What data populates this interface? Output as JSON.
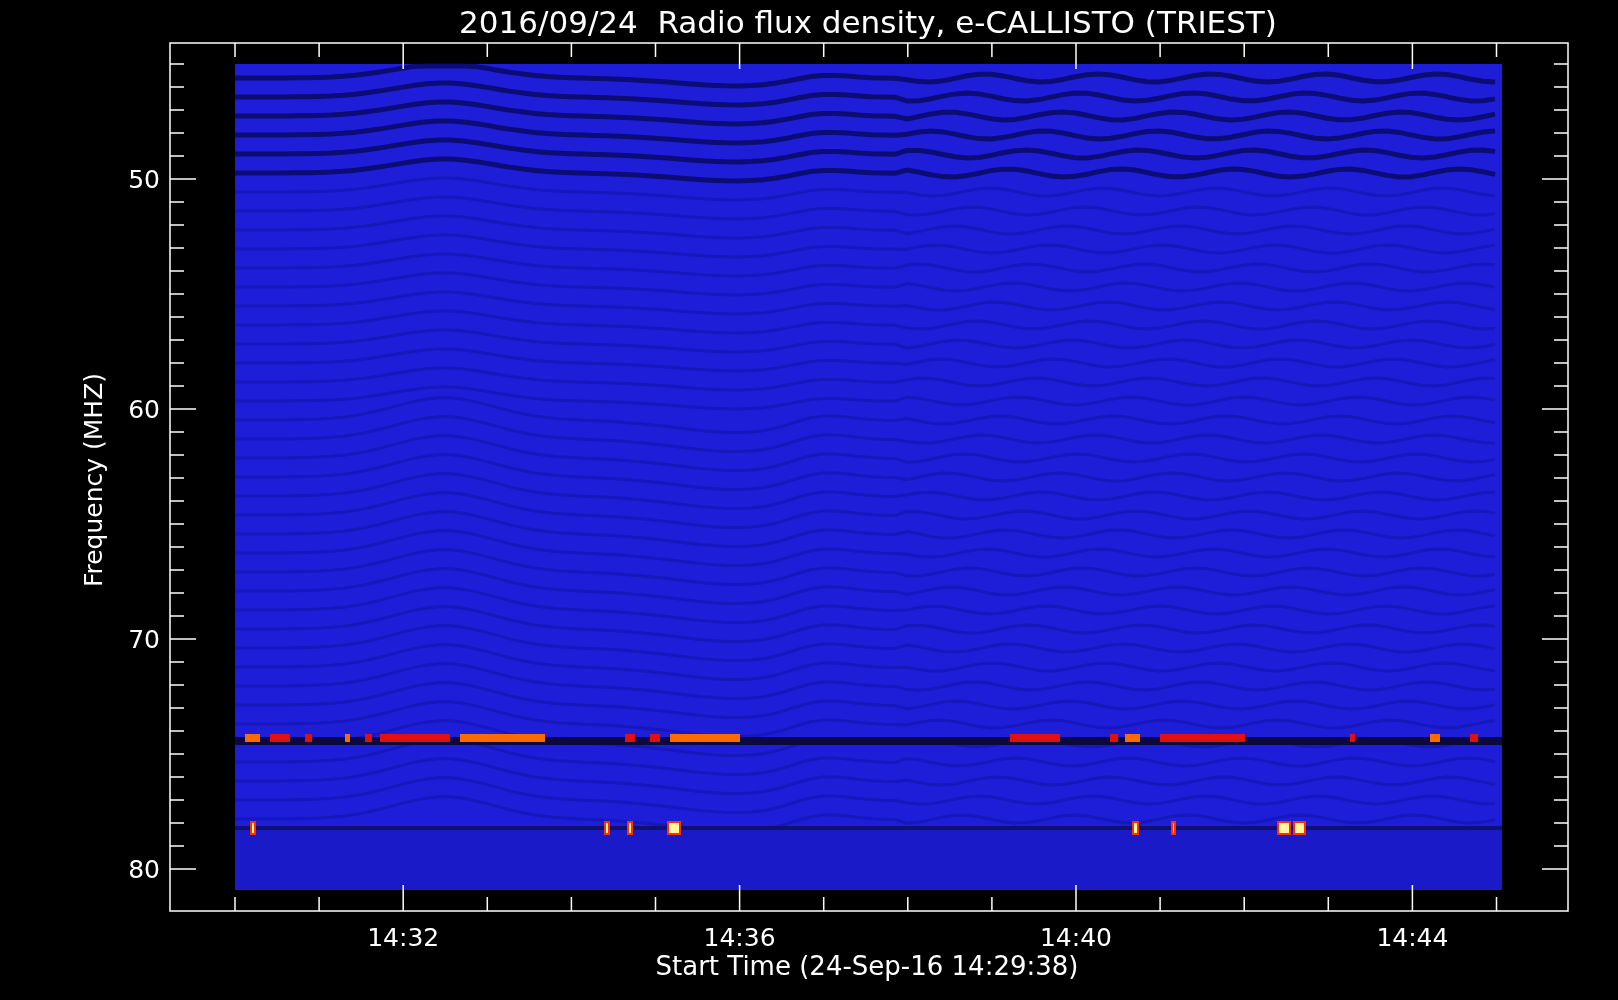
{
  "title": "2016/09/24  Radio flux density, e-CALLISTO (TRIEST)",
  "xlabel": "Start Time (24-Sep-16 14:29:38)",
  "ylabel": "Frequency (MHZ)",
  "xticks": [
    "14:32",
    "14:36",
    "14:40",
    "14:44"
  ],
  "yticks": [
    "50",
    "60",
    "70",
    "80"
  ]
}
